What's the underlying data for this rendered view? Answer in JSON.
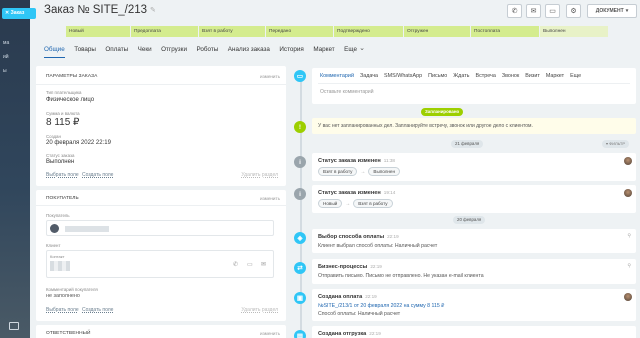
{
  "sidebar": {
    "tab_label": "Заказ",
    "items": [
      "ма",
      "ий",
      "ы"
    ]
  },
  "header": {
    "title_prefix": "Заказ №",
    "order_number": "SITE_/213",
    "document_button": "ДОКУМЕНТ"
  },
  "stages": [
    {
      "label": "Новый",
      "w": 64
    },
    {
      "label": "Предоплата",
      "w": 67
    },
    {
      "label": "Взят в работу",
      "w": 66
    },
    {
      "label": "Передано",
      "w": 67
    },
    {
      "label": "Подтверждено",
      "w": 69
    },
    {
      "label": "Отгружен",
      "w": 66
    },
    {
      "label": "Постоплата",
      "w": 68
    },
    {
      "label": "Выполнен",
      "w": 68,
      "last": true
    }
  ],
  "tabs": [
    "Общие",
    "Товары",
    "Оплаты",
    "Чеки",
    "Отгрузки",
    "Роботы",
    "Анализ заказа",
    "История",
    "Маркет",
    "Еще"
  ],
  "params": {
    "title": "ПАРАМЕТРЫ ЗАКАЗА",
    "edit": "изменить",
    "payer_type_label": "Тип плательщика",
    "payer_type": "Физическое лицо",
    "amount_label": "Сумма и валюта",
    "amount": "8 115 ₽",
    "created_label": "Создан",
    "created": "20 февраля 2022 22:19",
    "status_label": "Статус заказа",
    "status": "Выполнен",
    "choose_field": "Выбрать поле",
    "create_field": "Создать поле",
    "delete_section": "Удалить раздел"
  },
  "buyer": {
    "title": "ПОКУПАТЕЛЬ",
    "edit": "изменить",
    "buyer_label": "Покупатель",
    "client_label": "Клиент",
    "contact_label": "Контакт",
    "comment_label": "Комментарий покупателя",
    "comment": "не заполнено",
    "choose_field": "Выбрать поле",
    "create_field": "Создать поле",
    "delete_section": "Удалить раздел"
  },
  "responsible": {
    "title": "ОТВЕТСТВЕННЫЙ",
    "edit": "изменить"
  },
  "activity": {
    "tabs": [
      "Комментарий",
      "Задача",
      "SMS/WhatsApp",
      "Письмо",
      "Ждать",
      "Встреча",
      "Звонок",
      "Визит",
      "Маркет",
      "Еще"
    ],
    "placeholder": "Оставьте комментарий"
  },
  "timeline": {
    "planned_label": "Запланировано",
    "planned_text": "У вас нет запланированных дел. Запланируйте встречу, звонок или другое дело с клиентом.",
    "date1": "21 февраля",
    "filter": "ФИЛЬТР",
    "date2": "20 февраля",
    "events": [
      {
        "title": "Статус заказа изменен",
        "time": "11:38",
        "from": "Взят в работу",
        "to": "Выполнен",
        "icon_color": "#9aa5ac"
      },
      {
        "title": "Статус заказа изменен",
        "time": "19:14",
        "from": "Новый",
        "to": "Взят в работу",
        "icon_color": "#9aa5ac"
      },
      {
        "title": "Выбор способа оплаты",
        "time": "22:19",
        "text": "Клиент выбрал способ оплаты: Наличный расчет",
        "icon_color": "#2fc6f6"
      },
      {
        "title": "Бизнес-процессы",
        "time": "22:19",
        "text": "Отправить письмо. Письмо не отправлено. Не указан e-mail клиента",
        "icon_color": "#2fc6f6"
      },
      {
        "title": "Создана оплата",
        "time": "22:19",
        "text": "№SITE_/213/1 от 20 февраля 2022 на сумму 8 115 ₽",
        "text2": "Способ оплаты: Наличный расчет",
        "icon_color": "#2fc6f6"
      },
      {
        "title": "Создана отгрузка",
        "time": "22:19",
        "icon_color": "#2fc6f6"
      }
    ]
  }
}
